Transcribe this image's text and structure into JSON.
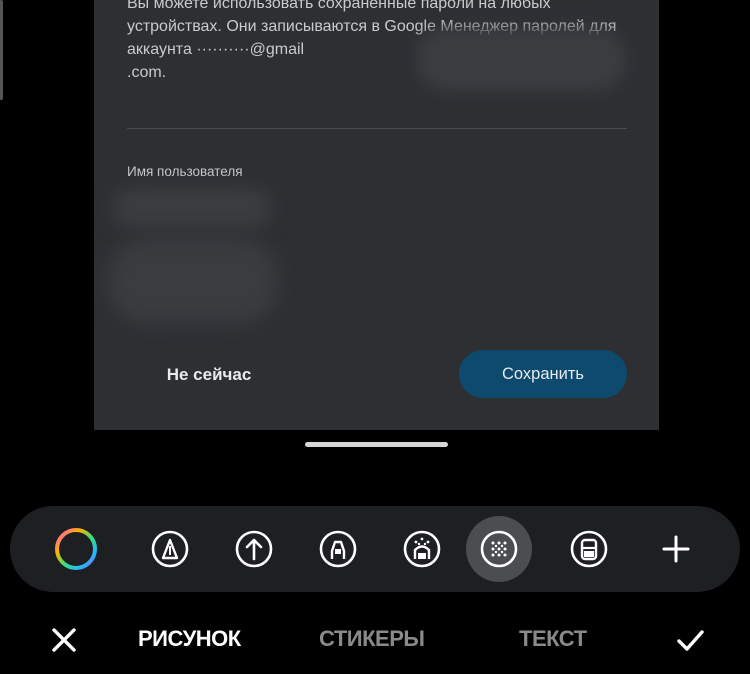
{
  "dialog": {
    "description": "Вы можете использовать сохраненные пароли на любых устройствах. Они записываются в Google Менеджер паролей для аккаунта",
    "email_suffix": ".com.",
    "username_label": "Имя пользователя",
    "cancel_label": "Не сейчас",
    "save_label": "Сохранить"
  },
  "toolbar": {
    "tools": [
      {
        "icon": "color-picker-icon"
      },
      {
        "icon": "pen-icon"
      },
      {
        "icon": "arrow-icon"
      },
      {
        "icon": "marker-icon"
      },
      {
        "icon": "spray-icon"
      },
      {
        "icon": "pixel-brush-icon",
        "selected": true
      },
      {
        "icon": "eraser-icon"
      },
      {
        "icon": "add-icon"
      }
    ]
  },
  "bottom_nav": {
    "tabs": [
      {
        "label": "РИСУНОК",
        "active": true
      },
      {
        "label": "СТИКЕРЫ",
        "active": false
      },
      {
        "label": "ТЕКСТ",
        "active": false
      }
    ]
  },
  "colors": {
    "dialog_bg": "#2d2f33",
    "save_button_bg": "#0e4a6e",
    "toolbar_bg": "#1d1f22"
  }
}
